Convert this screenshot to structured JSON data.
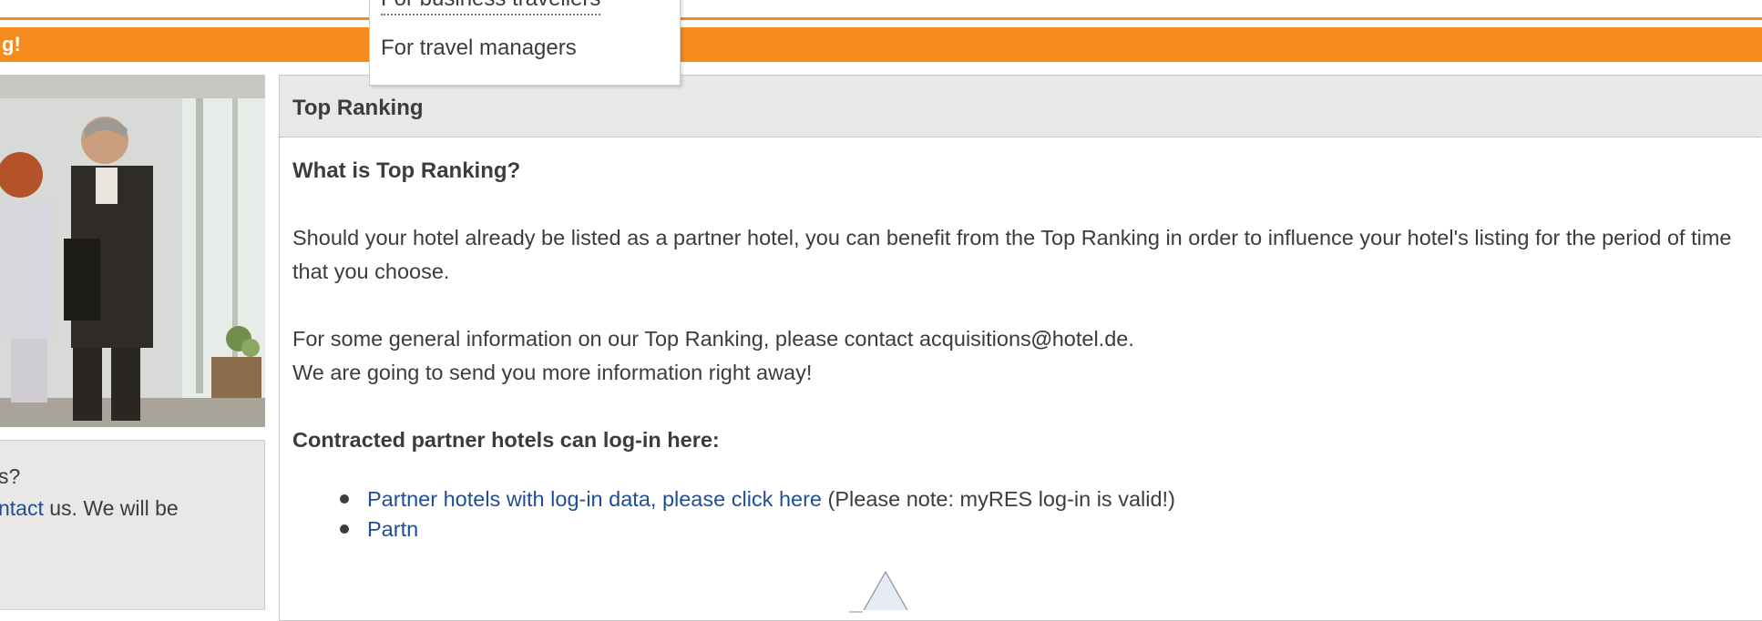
{
  "banner": {
    "text": "g!"
  },
  "dropdown": {
    "items": [
      "For business travellers",
      "For travel managers"
    ]
  },
  "sidebar": {
    "question_fragment": "s?",
    "contact_link": "ntact",
    "contact_rest": " us. We will be"
  },
  "panel": {
    "title": "Top Ranking",
    "heading": "What is Top Ranking?",
    "para1": "Should your hotel already be listed as a partner hotel, you can benefit from the Top Ranking in order to influence your hotel's listing for the period of time that you choose.",
    "para2_line1_pre": "For some general information on our Top Ranking, please contact acquisitions",
    "para2_at": "@",
    "para2_line1_post": "hotel.de.",
    "para2_line2": "We are going to send you more information right away!",
    "login_heading": "Contracted partner hotels can log-in here:",
    "links": [
      {
        "link_text": "Partner hotels with log-in data, please click here",
        "note": " (Please note: myRES log-in is valid!)"
      },
      {
        "link_text": "Partn",
        "note": ""
      }
    ]
  },
  "colors": {
    "accent": "#f68c1e",
    "link": "#1f4e96",
    "panel_header_bg": "#e9e8e6"
  }
}
